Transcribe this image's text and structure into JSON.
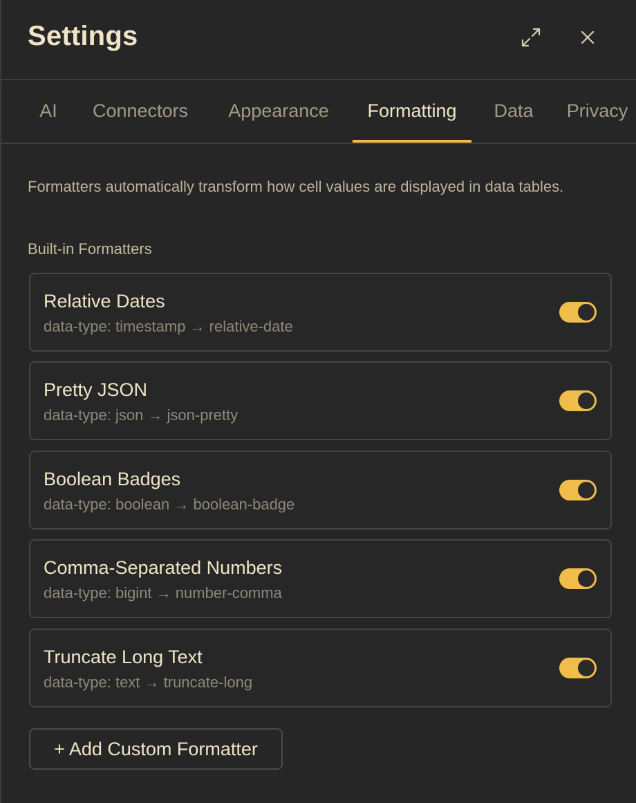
{
  "header": {
    "title": "Settings",
    "expand_icon": "expand-icon",
    "close_icon": "close-icon"
  },
  "tabs": [
    {
      "label": "AI",
      "active": false
    },
    {
      "label": "Connectors",
      "active": false
    },
    {
      "label": "Appearance",
      "active": false
    },
    {
      "label": "Formatting",
      "active": true
    },
    {
      "label": "Data",
      "active": false
    },
    {
      "label": "Privacy",
      "active": false
    }
  ],
  "main": {
    "description": "Formatters automatically transform how cell values are displayed in data tables.",
    "section_label": "Built-in Formatters",
    "formatters": [
      {
        "name": "Relative Dates",
        "mapping": "data-type: timestamp → relative-date",
        "enabled": true
      },
      {
        "name": "Pretty JSON",
        "mapping": "data-type: json → json-pretty",
        "enabled": true
      },
      {
        "name": "Boolean Badges",
        "mapping": "data-type: boolean → boolean-badge",
        "enabled": true
      },
      {
        "name": "Comma-Separated Numbers",
        "mapping": "data-type: bigint → number-comma",
        "enabled": true
      },
      {
        "name": "Truncate Long Text",
        "mapping": "data-type: text → truncate-long",
        "enabled": true
      }
    ],
    "add_button_label": "+ Add Custom Formatter"
  },
  "colors": {
    "accent": "#f0bd4b",
    "background": "#262626",
    "text": "#efe5c6",
    "muted_text": "#8f887a"
  }
}
